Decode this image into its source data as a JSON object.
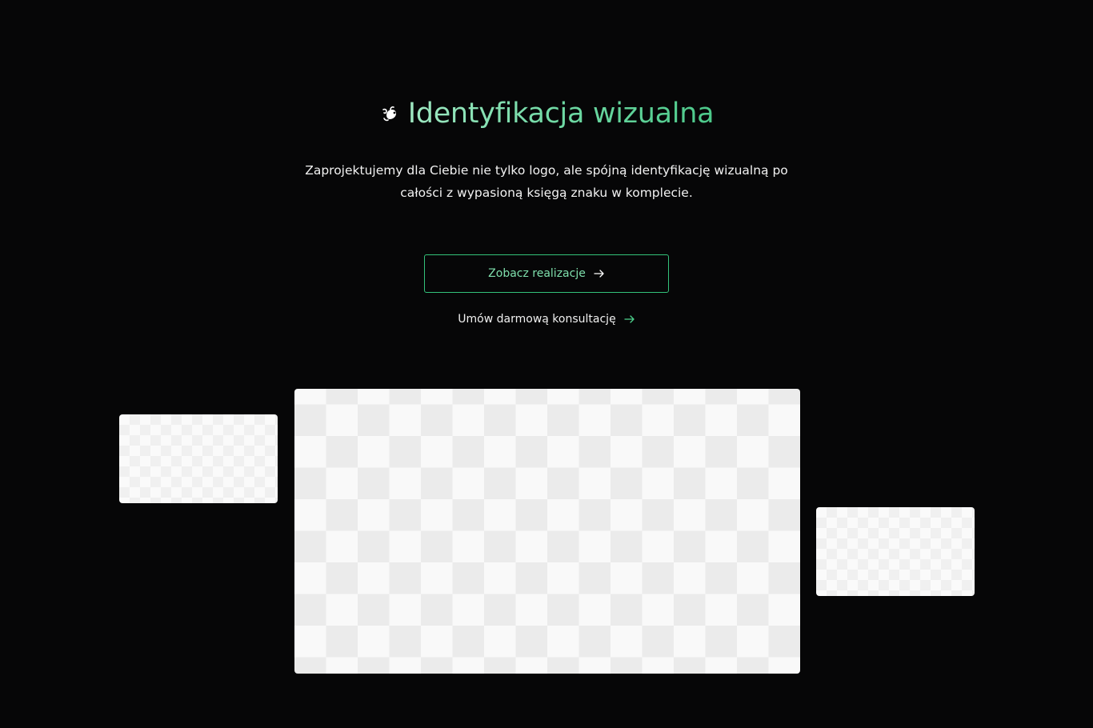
{
  "hero": {
    "title": "Identyfikacja wizualna",
    "description": "Zaprojektujemy dla Ciebie nie tylko logo, ale spójną identyfikację wizualną po całości z wypasioną księgą znaku w komplecie.",
    "icon": "fleuron-icon"
  },
  "actions": {
    "primary_label": "Zobacz realizacje",
    "secondary_label": "Umów darmową konsultację"
  },
  "colors": {
    "background": "#060607",
    "accent": "#33c27a",
    "accent_text": "#7fe0ad"
  },
  "gallery": {
    "images": [
      "transparent-placeholder",
      "transparent-placeholder",
      "transparent-placeholder"
    ]
  }
}
